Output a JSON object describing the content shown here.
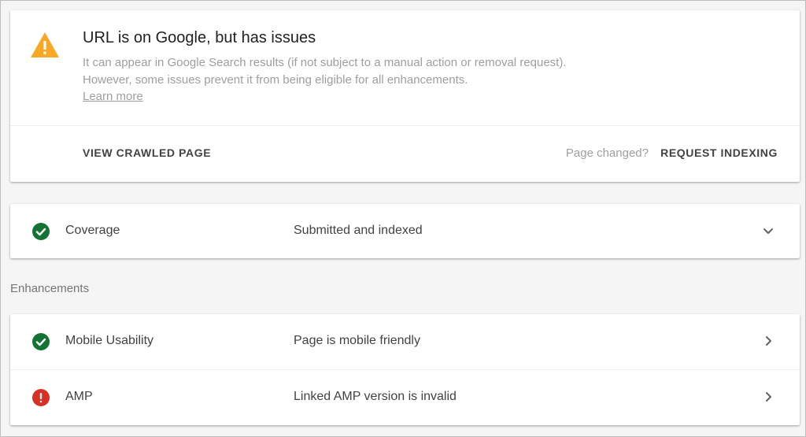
{
  "status": {
    "title": "URL is on Google, but has issues",
    "description": "It can appear in Google Search results (if not subject to a manual action or removal request). However, some issues prevent it from being eligible for all enhancements.",
    "learn_more": "Learn more",
    "view_crawled_label": "VIEW CRAWLED PAGE",
    "page_changed_text": "Page changed?",
    "request_indexing_label": "REQUEST INDEXING",
    "icon": "warning-icon",
    "icon_color": "#f9a825"
  },
  "coverage": {
    "label": "Coverage",
    "value": "Submitted and indexed",
    "icon": "check-circle-icon",
    "icon_color": "#137333"
  },
  "enhancements": {
    "heading": "Enhancements",
    "items": [
      {
        "label": "Mobile Usability",
        "value": "Page is mobile friendly",
        "icon": "check-circle-icon",
        "icon_color": "#137333"
      },
      {
        "label": "AMP",
        "value": "Linked AMP version is invalid",
        "icon": "error-circle-icon",
        "icon_color": "#d93025"
      }
    ]
  }
}
